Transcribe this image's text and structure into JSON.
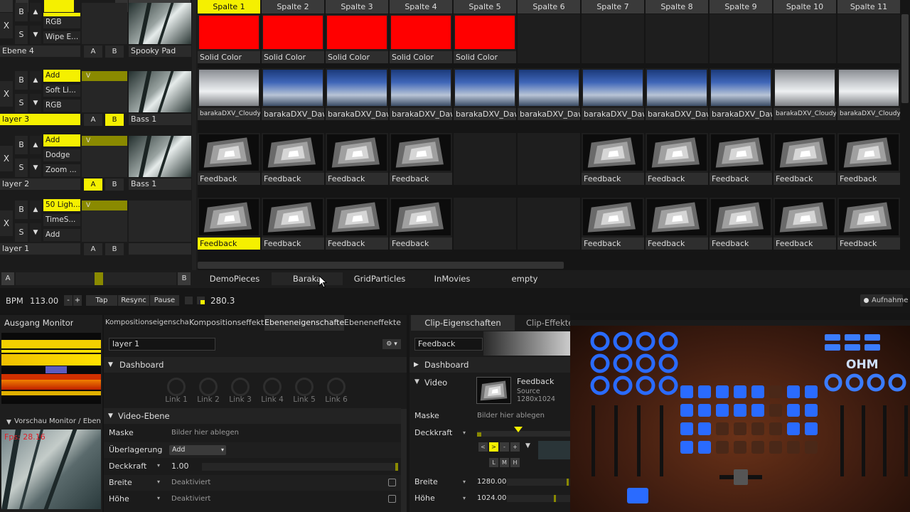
{
  "columns": {
    "mode_labels": [
      "B",
      "M"
    ],
    "composition_label": "Komposition",
    "headers": [
      "Spalte 1",
      "Spalte 2",
      "Spalte 3",
      "Spalte 4",
      "Spalte 5",
      "Spalte 6",
      "Spalte 7",
      "Spalte 8",
      "Spalte 9",
      "Spalte 10",
      "Spalte 11"
    ],
    "selected_header_index": 0
  },
  "layers": [
    {
      "name": "Ebene 4",
      "x": "X",
      "b": "B",
      "s": "S",
      "blend": [
        "",
        "RGB",
        "Wipe E..."
      ],
      "a": "A",
      "bb": "B",
      "highlight_a": false,
      "highlight_b": false,
      "name_highlight": false,
      "preview_label": "Spooky Pad",
      "clips": [
        {
          "label": "Solid Color",
          "kind": "red"
        },
        {
          "label": "Solid Color",
          "kind": "red"
        },
        {
          "label": "Solid Color",
          "kind": "red"
        },
        {
          "label": "Solid Color",
          "kind": "red"
        },
        {
          "label": "Solid Color",
          "kind": "red"
        },
        null,
        null,
        null,
        null,
        null,
        null
      ]
    },
    {
      "name": "layer 3",
      "x": "X",
      "b": "B",
      "s": "S",
      "blend": [
        "Add",
        "Soft Li...",
        "RGB"
      ],
      "v": "V",
      "a": "A",
      "bb": "B",
      "highlight_a": false,
      "highlight_b": true,
      "name_highlight": true,
      "preview_label": "Bass 1",
      "clips": [
        {
          "label": "barakaDXV_Cloudy...",
          "kind": "cloud"
        },
        {
          "label": "barakaDXV_Dawn",
          "kind": "sky"
        },
        {
          "label": "barakaDXV_Dawn",
          "kind": "sky"
        },
        {
          "label": "barakaDXV_Dawn",
          "kind": "sky"
        },
        {
          "label": "barakaDXV_Dawn",
          "kind": "sky"
        },
        {
          "label": "barakaDXV_Dawn",
          "kind": "sky"
        },
        {
          "label": "barakaDXV_Dawn",
          "kind": "sky"
        },
        {
          "label": "barakaDXV_Dawn",
          "kind": "sky"
        },
        {
          "label": "barakaDXV_Dawn",
          "kind": "sky"
        },
        {
          "label": "barakaDXV_Cloudy...",
          "kind": "cloud"
        },
        {
          "label": "barakaDXV_Cloudy...",
          "kind": "cloud"
        }
      ]
    },
    {
      "name": "layer 2",
      "x": "X",
      "b": "B",
      "s": "S",
      "blend": [
        "Add",
        "Dodge",
        "Zoom ..."
      ],
      "v": "V",
      "a": "A",
      "bb": "B",
      "highlight_a": true,
      "highlight_b": false,
      "name_highlight": false,
      "preview_label": "Bass 1",
      "clips": [
        {
          "label": "Feedback",
          "kind": "fb"
        },
        {
          "label": "Feedback",
          "kind": "fb"
        },
        {
          "label": "Feedback",
          "kind": "fb"
        },
        {
          "label": "Feedback",
          "kind": "fb"
        },
        null,
        null,
        {
          "label": "Feedback",
          "kind": "fb"
        },
        {
          "label": "Feedback",
          "kind": "fb"
        },
        {
          "label": "Feedback",
          "kind": "fb"
        },
        {
          "label": "Feedback",
          "kind": "fb"
        },
        {
          "label": "Feedback",
          "kind": "fb"
        }
      ]
    },
    {
      "name": "layer 1",
      "x": "X",
      "b": "B",
      "s": "S",
      "blend": [
        "50 Ligh...",
        "TimeS...",
        "Add"
      ],
      "v": "V",
      "a": "A",
      "bb": "B",
      "highlight_a": false,
      "highlight_b": false,
      "name_highlight": false,
      "preview_label": "",
      "clips": [
        {
          "label": "Feedback",
          "kind": "fb",
          "active": true
        },
        {
          "label": "Feedback",
          "kind": "fb"
        },
        {
          "label": "Feedback",
          "kind": "fb"
        },
        {
          "label": "Feedback",
          "kind": "fb"
        },
        null,
        null,
        {
          "label": "Feedback",
          "kind": "fb"
        },
        {
          "label": "Feedback",
          "kind": "fb"
        },
        {
          "label": "Feedback",
          "kind": "fb"
        },
        {
          "label": "Feedback",
          "kind": "fb"
        },
        {
          "label": "Feedback",
          "kind": "fb"
        }
      ]
    }
  ],
  "crossfader": {
    "a": "A",
    "b": "B",
    "position": 0.52
  },
  "deck_tabs": [
    "DemoPieces",
    "Baraka",
    "GridParticles",
    "InMovies",
    "empty"
  ],
  "transport": {
    "bpm_label": "BPM",
    "bpm_value": "113.00",
    "minus": "-",
    "plus": "+",
    "tap": "Tap",
    "resync": "Resync",
    "pause": "Pause",
    "value": "280.3",
    "record": "Aufnahme"
  },
  "output_monitor": {
    "title": "Ausgang Monitor"
  },
  "preview_monitor": {
    "title": "Vorschau Monitor / Ebene / ...",
    "fps": "Fps: 28.16"
  },
  "layer_panel": {
    "tabs": [
      "Kompositionseigenschaften",
      "Kompositionseffekte",
      "Ebeneneigenschaften",
      "Ebeneneffekte"
    ],
    "active_tab": 2,
    "layer_name": "layer 1",
    "gear": "⚙ ▾",
    "dashboard": "Dashboard",
    "links": [
      "Link 1",
      "Link 2",
      "Link 3",
      "Link 4",
      "Link 5",
      "Link 6"
    ],
    "video_section": "Video-Ebene",
    "rows": [
      {
        "label": "Maske",
        "value": "Bilder hier ablegen"
      },
      {
        "label": "Überlagerung",
        "value": "Add"
      },
      {
        "label": "Deckkraft",
        "value": "1.00"
      },
      {
        "label": "Breite",
        "value": "Deaktiviert"
      },
      {
        "label": "Höhe",
        "value": "Deaktiviert"
      }
    ],
    "opacity_fraction": 1.0
  },
  "clip_panel": {
    "tabs": [
      "Clip-Eigenschaften",
      "Clip-Effekte"
    ],
    "clip_name": "Feedback",
    "dashboard": "Dashboard",
    "video": "Video",
    "source_name": "Feedback",
    "source_label": "Source",
    "source_size": "1280x1024",
    "rows": [
      {
        "label": "Maske",
        "value": "Bilder hier ablegen"
      },
      {
        "label": "Deckkraft",
        "value": ""
      },
      {
        "label": "Breite",
        "value": "1280.00"
      },
      {
        "label": "Höhe",
        "value": "1024.00"
      }
    ],
    "playback_buttons": [
      "<",
      ">",
      "-",
      "+"
    ],
    "lmh": [
      "L",
      "M",
      "H"
    ]
  },
  "colors": {
    "accent": "#f5f000",
    "red": "#ff0000",
    "panel": "#232323",
    "controller_glow": "#2a6bff"
  }
}
